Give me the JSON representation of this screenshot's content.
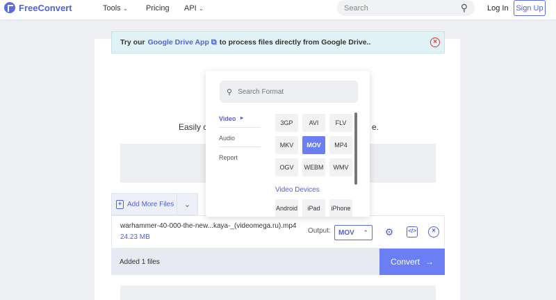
{
  "header": {
    "brand": "FreeConvert",
    "nav": [
      "Tools",
      "Pricing",
      "API"
    ],
    "search_placeholder": "Search",
    "login": "Log In",
    "signup": "Sign Up"
  },
  "banner": {
    "prefix": "Try our",
    "link": "Google Drive App",
    "suffix": "to process files directly from Google Drive.."
  },
  "intro": {
    "start": "Easily c",
    "end": "e."
  },
  "popup": {
    "search_placeholder": "Search Format",
    "categories": [
      "Video",
      "Audio",
      "Report"
    ],
    "formats": [
      "3GP",
      "AVI",
      "FLV",
      "MKV",
      "MOV",
      "MP4",
      "OGV",
      "WEBM",
      "WMV"
    ],
    "selected_format": "MOV",
    "section_title": "Video Devices",
    "devices": [
      "Android",
      "iPad",
      "iPhone"
    ]
  },
  "add_files": {
    "label": "Add More Files"
  },
  "file": {
    "name": "warhammer-40-000-the-new...kaya-_(videomega.ru).mp4",
    "size": "24.23 MB",
    "output_label": "Output:",
    "output_value": "MOV"
  },
  "status": {
    "text": "Added 1 files"
  },
  "convert": {
    "label": "Convert"
  }
}
